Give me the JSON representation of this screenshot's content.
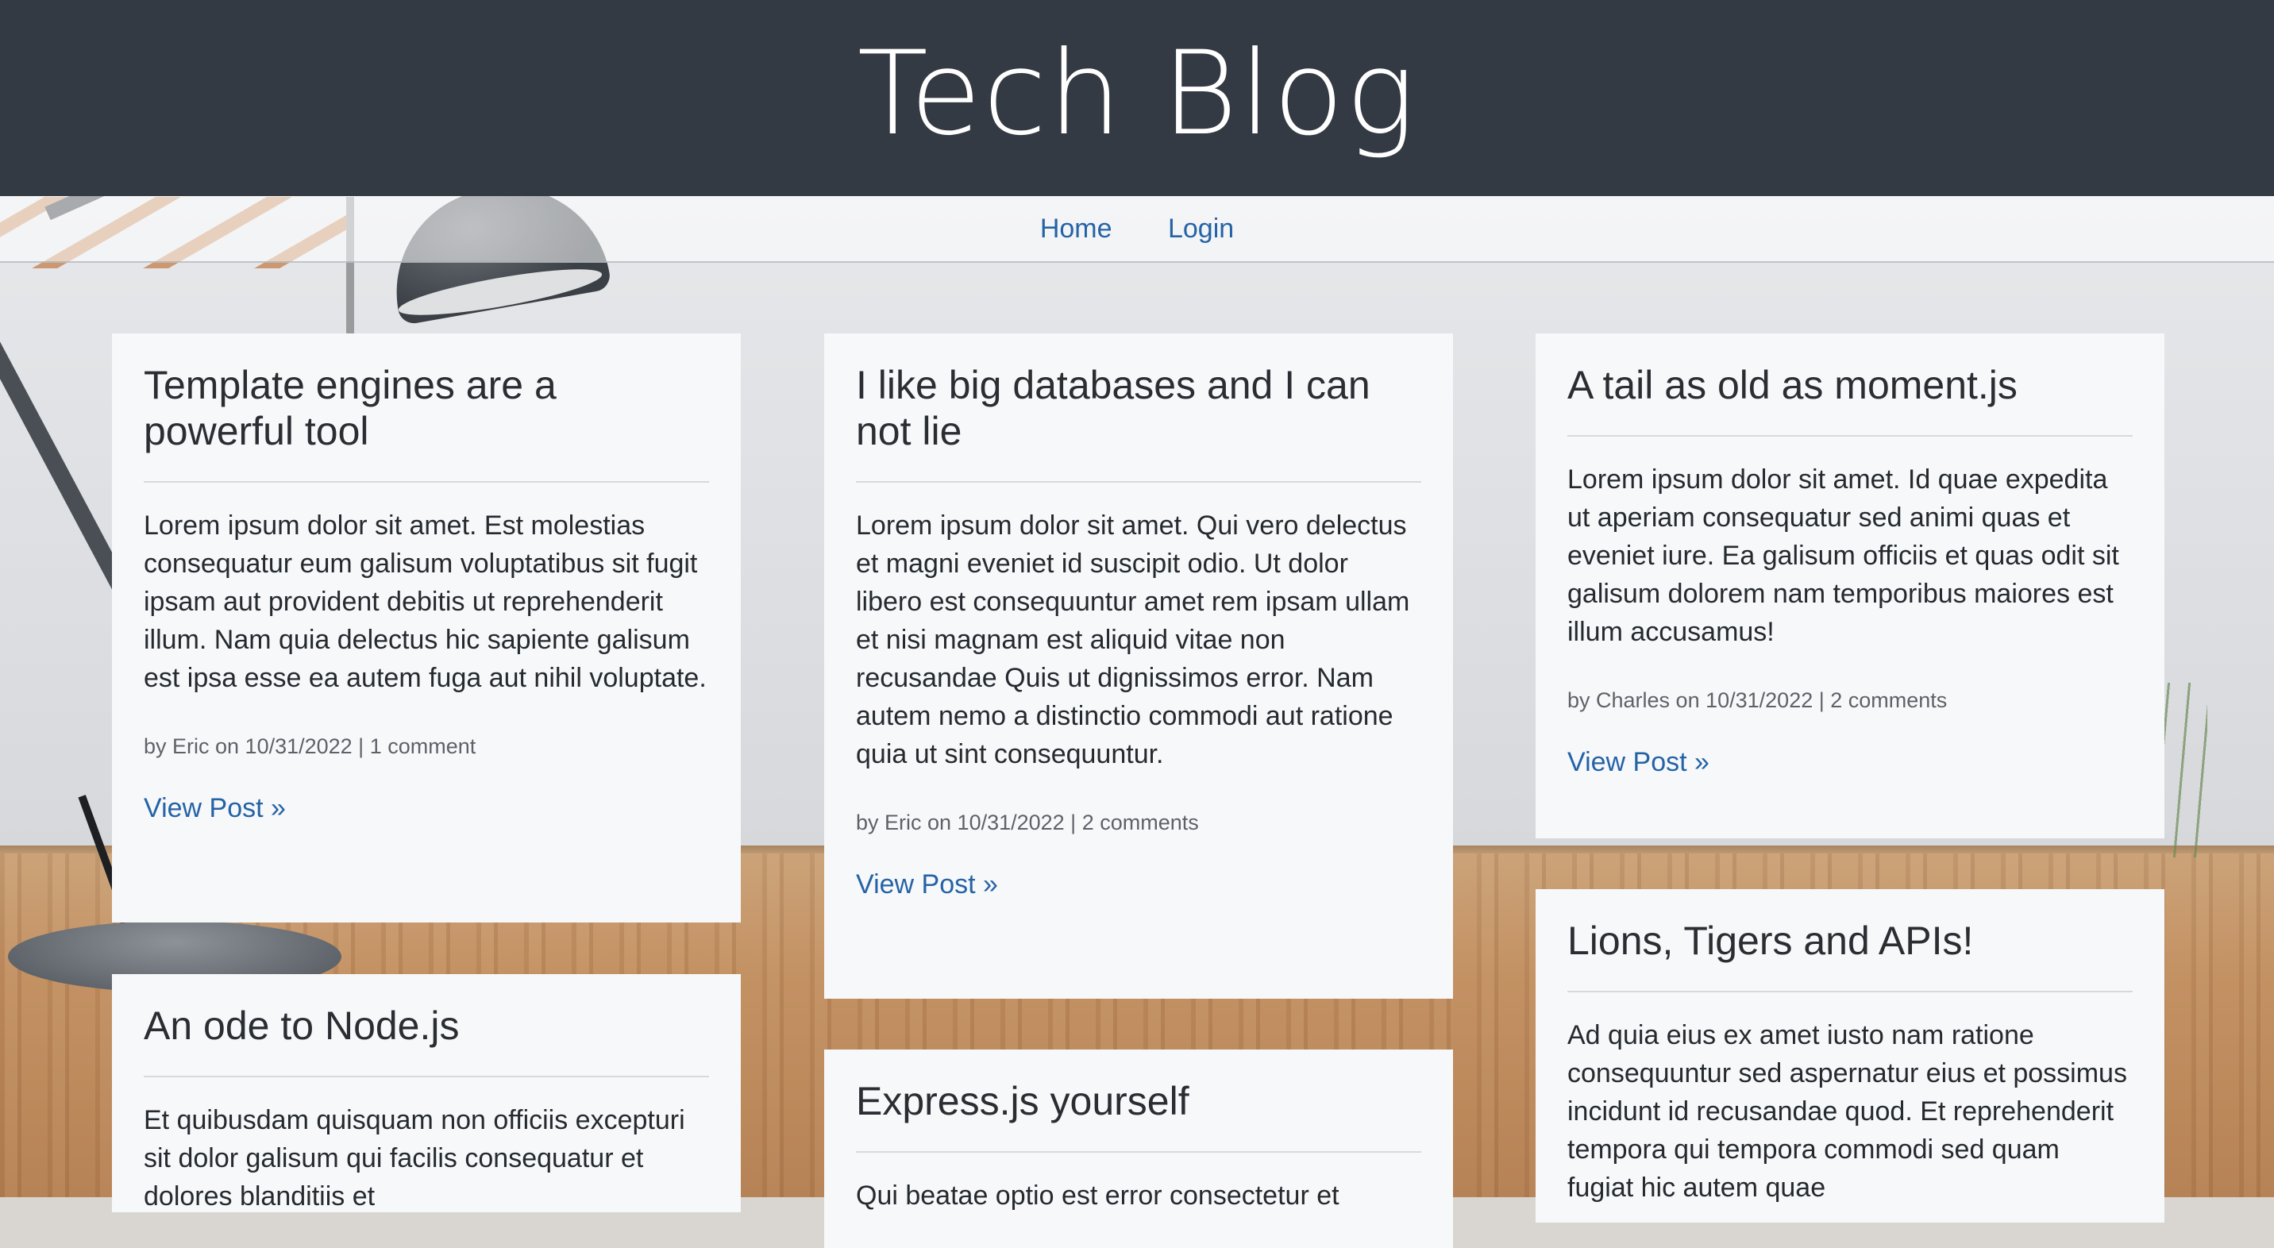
{
  "site": {
    "title": "Tech Blog"
  },
  "nav": {
    "home": "Home",
    "login": "Login"
  },
  "posts": [
    {
      "title": "Template engines are a powerful tool",
      "body": "Lorem ipsum dolor sit amet. Est molestias consequatur eum galisum voluptatibus sit fugit ipsam aut provident debitis ut reprehenderit illum. Nam quia delectus hic sapiente galisum est ipsa esse ea autem fuga aut nihil voluptate.",
      "meta": "by Eric on 10/31/2022 | 1 comment",
      "link": "View Post »"
    },
    {
      "title": "I like big databases and I can not lie",
      "body": "Lorem ipsum dolor sit amet. Qui vero delectus et magni eveniet id suscipit odio. Ut dolor libero est consequuntur amet rem ipsam ullam et nisi magnam est aliquid vitae non recusandae Quis ut dignissimos error. Nam autem nemo a distinctio commodi aut ratione quia ut sint consequuntur.",
      "meta": "by Eric on 10/31/2022 | 2 comments",
      "link": "View Post »"
    },
    {
      "title": "A tail as old as moment.js",
      "body": "Lorem ipsum dolor sit amet. Id quae expedita ut aperiam consequatur sed animi quas et eveniet iure. Ea galisum officiis et quas odit sit galisum dolorem nam temporibus maiores est illum accusamus!",
      "meta": "by Charles on 10/31/2022 | 2 comments",
      "link": "View Post »"
    },
    {
      "title": "An ode to Node.js",
      "body": "Et quibusdam quisquam non officiis excepturi sit dolor galisum qui facilis consequatur et dolores blanditiis et"
    },
    {
      "title": "Express.js yourself",
      "body": "Qui beatae optio est error consectetur et"
    },
    {
      "title": "Lions, Tigers and APIs!",
      "body": "Ad quia eius ex amet iusto nam ratione consequuntur sed aspernatur eius et possimus incidunt id recusandae quod. Et reprehenderit tempora qui tempora commodi sed quam fugiat hic autem quae"
    }
  ]
}
